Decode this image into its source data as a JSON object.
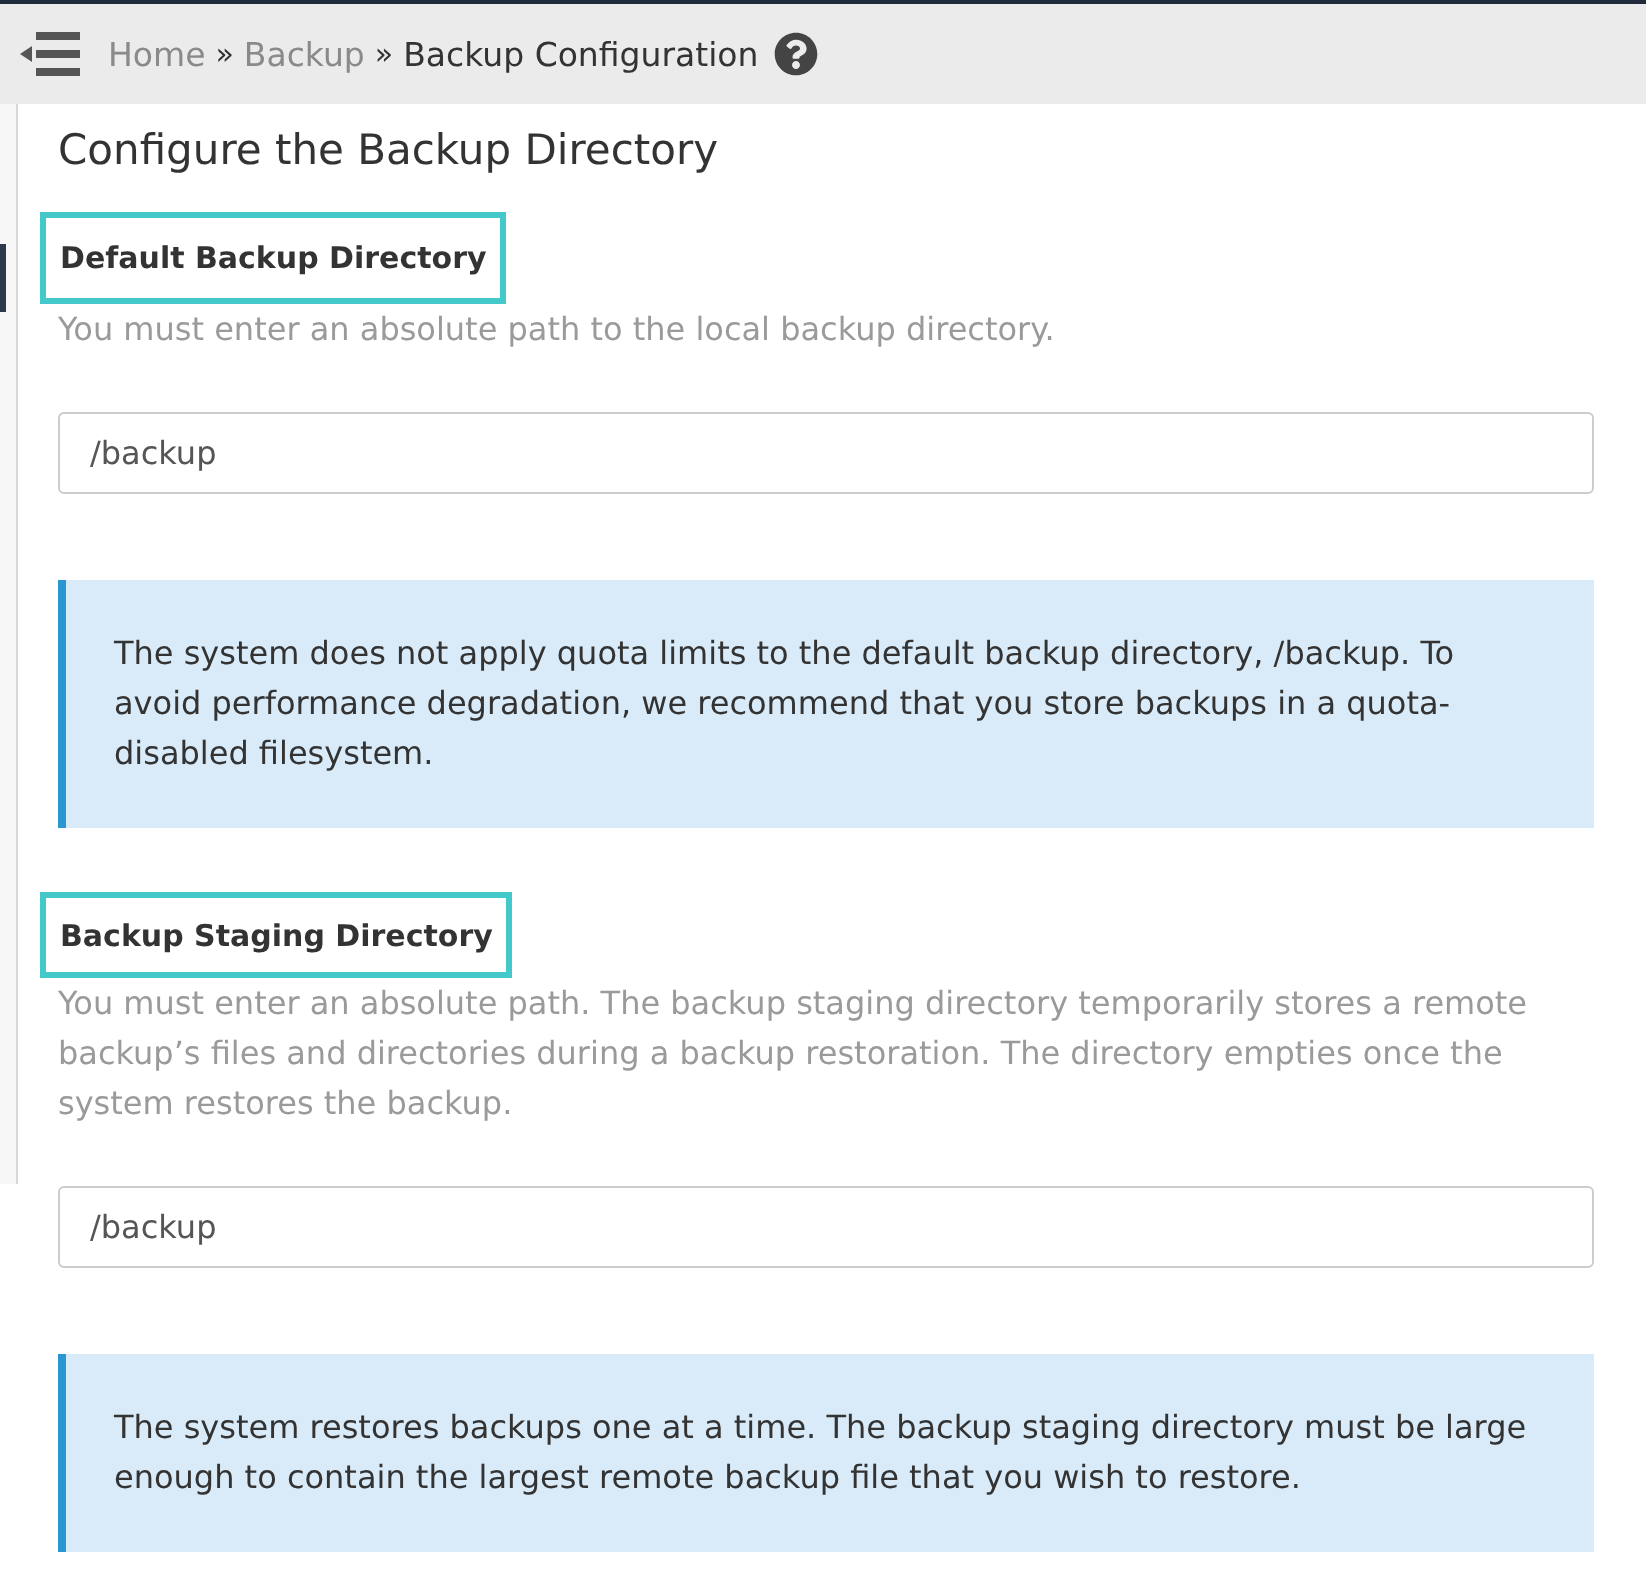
{
  "header": {
    "breadcrumb": [
      {
        "label": "Home",
        "kind": "link"
      },
      {
        "label": "»",
        "kind": "separator"
      },
      {
        "label": "Backup",
        "kind": "link"
      },
      {
        "label": "»",
        "kind": "separator"
      },
      {
        "label": "Backup Configuration",
        "kind": "current"
      }
    ]
  },
  "page_title": "Configure the Backup Directory",
  "sections": [
    {
      "label": "Default Backup Directory",
      "highlighted": true,
      "help": "You must enter an absolute path to the local backup directory.",
      "value": "/backup",
      "note": "The system does not apply quota limits to the default backup directory, /backup. To avoid performance degradation, we recommend that you store backups in a quota-disabled filesystem."
    },
    {
      "label": "Backup Staging Directory",
      "highlighted": true,
      "help": "You must enter an absolute path. The backup staging directory temporarily stores a remote backup’s files and directories during a backup restoration. The directory empties once the system restores the backup.",
      "value": "/backup",
      "note": "The system restores backups one at a time. The backup staging directory must be large enough to contain the largest remote backup file that you wish to restore."
    }
  ]
}
